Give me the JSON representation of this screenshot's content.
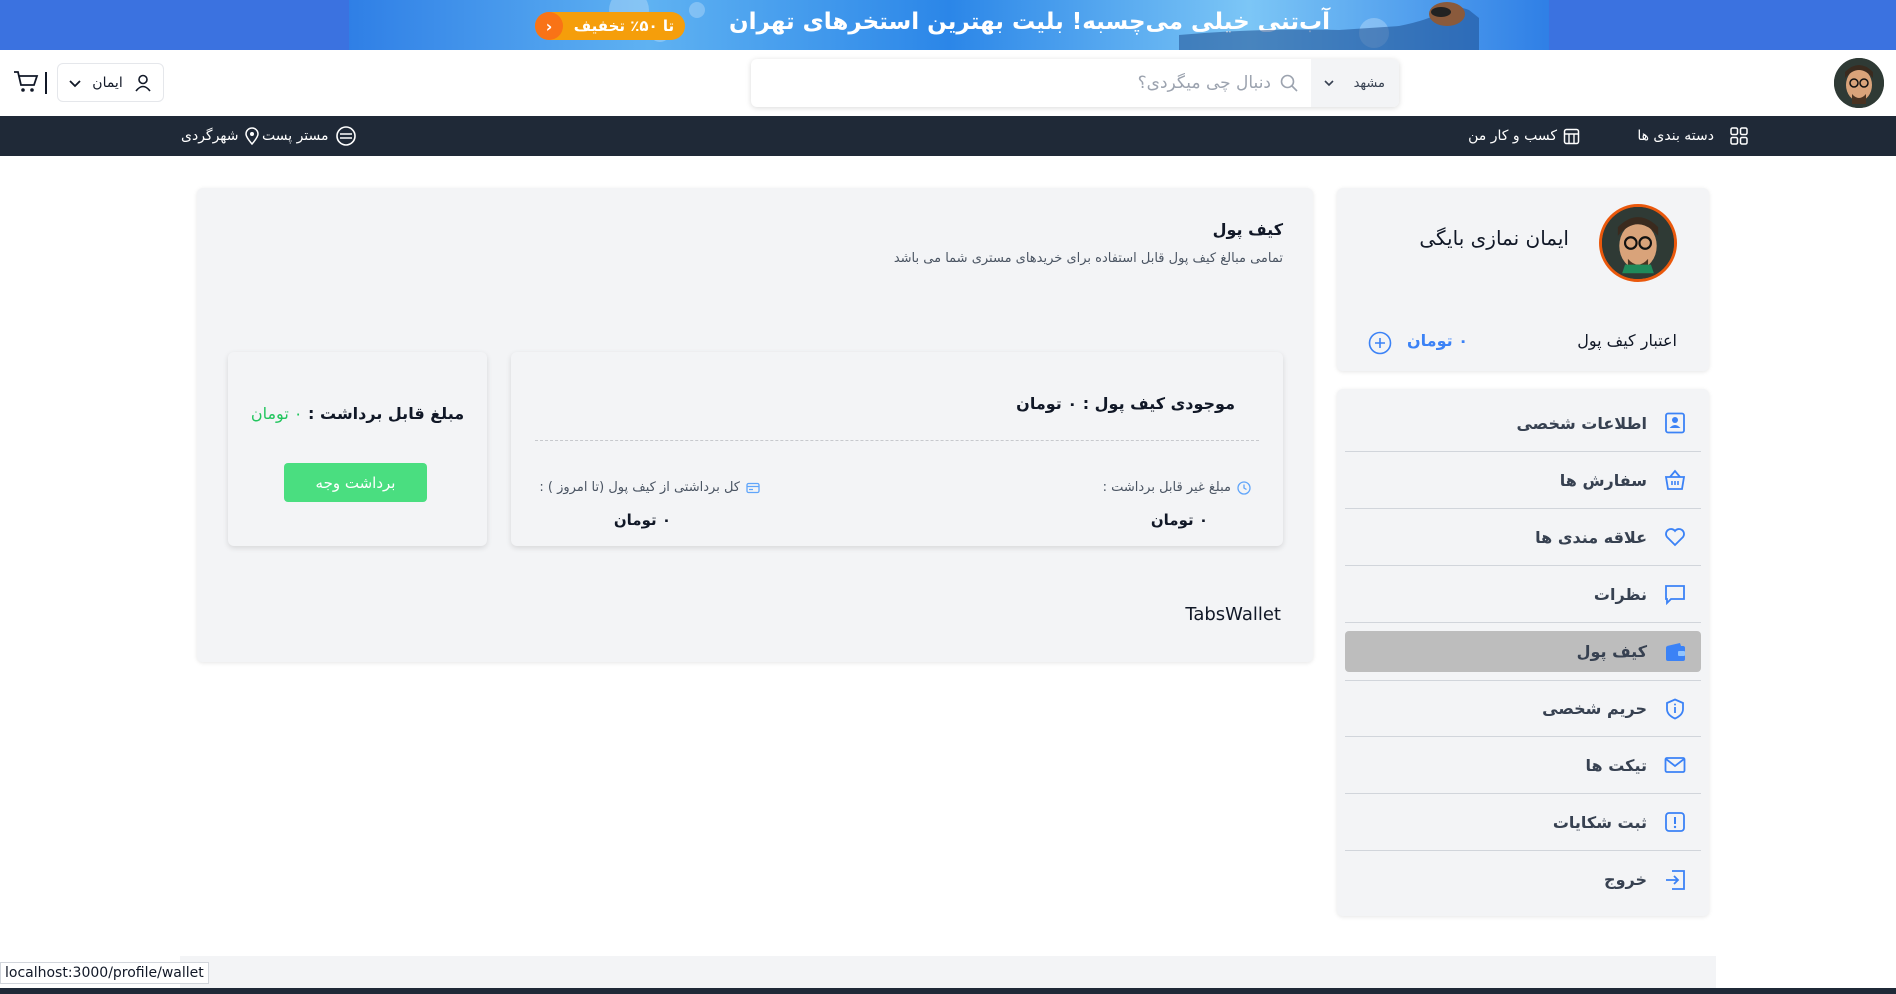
{
  "banner": {
    "title": "آب‌تنی خیلی می‌چسبه! بلیت بهترین استخرهای تهران",
    "discount": "تا ۵۰٪ تخفیف"
  },
  "header": {
    "city": "مشهد",
    "search_placeholder": "دنبال چی میگردی؟",
    "user_name": "ایمان"
  },
  "nav": {
    "categories": "دسته بندی ها",
    "my_business": "کسب و کار من",
    "master_post": "مستر پست",
    "tourism": "شهرگردی"
  },
  "profile": {
    "name": "ایمان نمازی بایگی",
    "wallet_credit_label": "اعتبار کیف پول",
    "wallet_credit_value": "۰ تومان"
  },
  "menu": {
    "items": [
      {
        "label": "اطلاعات شخصی",
        "icon": "profile-card-icon"
      },
      {
        "label": "سفارش ها",
        "icon": "basket-icon"
      },
      {
        "label": "علاقه مندی ها",
        "icon": "heart-icon"
      },
      {
        "label": "نظرات",
        "icon": "comment-icon"
      },
      {
        "label": "کیف پول",
        "icon": "wallet-icon",
        "active": true
      },
      {
        "label": "حریم شخصی",
        "icon": "shield-icon"
      },
      {
        "label": "تیکت ها",
        "icon": "envelope-icon"
      },
      {
        "label": "ثبت شکایات",
        "icon": "alert-icon"
      },
      {
        "label": "خروج",
        "icon": "logout-icon"
      }
    ]
  },
  "wallet": {
    "title": "کیف پول",
    "subtitle": "تمامی مبالغ کیف پول قابل استفاده برای خریدهای مستری شما می باشد",
    "balance_title": "موجودی کیف پول : ۰ تومان",
    "non_withdrawable_label": "مبلغ غیر قابل برداشت :",
    "non_withdrawable_value": "۰ تومان",
    "total_withdrawn_label": "کل برداشتی از کیف پول (تا امروز ) :",
    "total_withdrawn_value": "۰ تومان",
    "withdrawable_label": "مبلغ قابل برداشت :",
    "withdrawable_value": "۰ تومان",
    "withdraw_button": "برداشت وجه",
    "tabs_label": "TabsWallet"
  },
  "status_bar": {
    "url": "localhost:3000/profile/wallet"
  },
  "colors": {
    "accent_blue": "#3b82f6",
    "nav_bg": "#1f2937",
    "success_green": "#4ade80",
    "active_menu_bg": "#bdbdbd"
  }
}
